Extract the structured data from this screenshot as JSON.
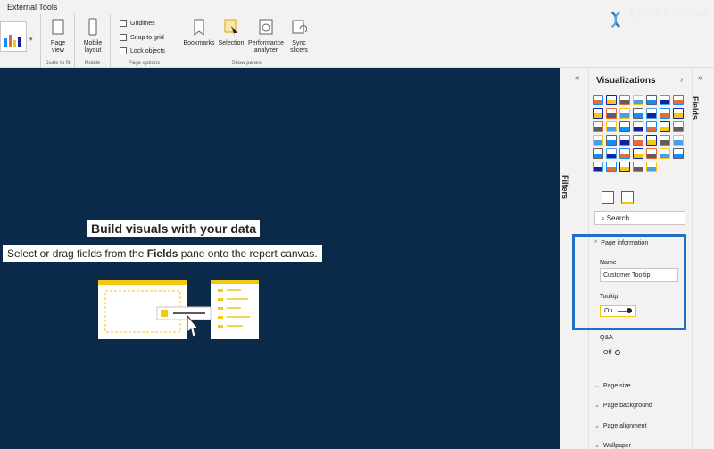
{
  "ribbon": {
    "title": "External Tools",
    "groups": {
      "scale_to_fit": "Scale to fit",
      "mobile": "Mobile",
      "page_options": "Page options",
      "show_panes": "Show panes"
    },
    "buttons": {
      "page_view": "Page view",
      "mobile_layout": "Mobile layout",
      "bookmarks": "Bookmarks",
      "selection": "Selection",
      "performance_analyzer": "Performance analyzer",
      "sync_slicers": "Sync slicers"
    },
    "checkboxes": {
      "gridlines": "Gridlines",
      "snap_to_grid": "Snap to grid",
      "lock_objects": "Lock objects"
    }
  },
  "brand": {
    "text": "ENTERPRISE D"
  },
  "canvas": {
    "headline": "Build visuals with your data",
    "sub_prefix": "Select or drag fields from the ",
    "sub_bold": "Fields",
    "sub_suffix": " pane onto the report canvas."
  },
  "filters": {
    "label": "Filters"
  },
  "visualizations": {
    "title": "Visualizations",
    "search_placeholder": "Search",
    "page_information": "Page information",
    "name_label": "Name",
    "name_value": "Customer Tooltip",
    "tooltip_label": "Tooltip",
    "tooltip_state": "On",
    "qa_label": "Q&A",
    "qa_state": "Off",
    "sections": [
      "Page size",
      "Page background",
      "Page alignment",
      "Wallpaper"
    ]
  },
  "fields": {
    "label": "Fields"
  },
  "colors": {
    "canvas_bg": "#0b2a4a",
    "accent_yellow": "#f2c811",
    "highlight_blue": "#1f6fc5"
  }
}
